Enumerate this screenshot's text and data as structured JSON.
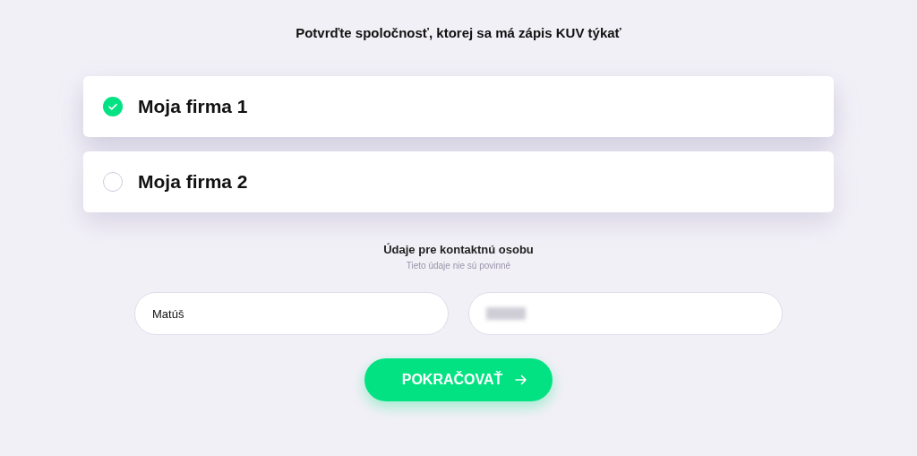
{
  "title": "Potvrďte spoločnosť, ktorej sa má zápis KUV týkať",
  "companies": [
    {
      "name": "Moja firma 1",
      "selected": true
    },
    {
      "name": "Moja firma 2",
      "selected": false
    }
  ],
  "contact": {
    "heading": "Údaje pre kontaktnú osobu",
    "subtitle": "Tieto údaje nie sú povinné",
    "fields": [
      {
        "value": "Matúš",
        "blurred": false
      },
      {
        "blurred": true
      }
    ]
  },
  "button": {
    "label": "POKRAČOVAŤ"
  }
}
